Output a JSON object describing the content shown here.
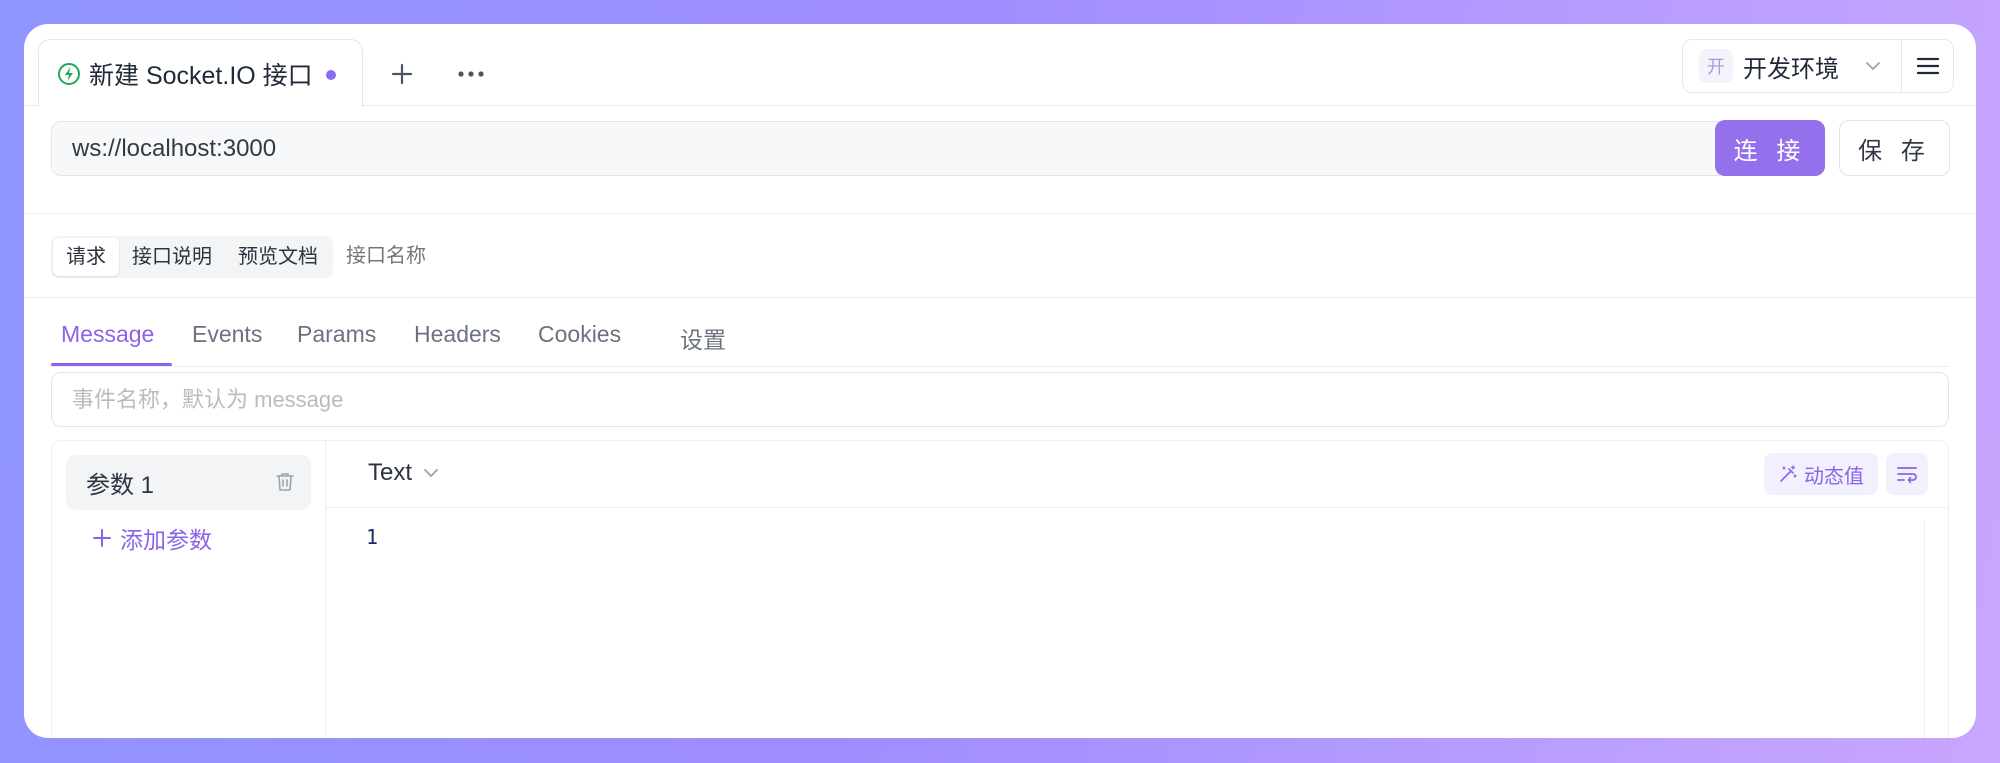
{
  "tab": {
    "title": "新建 Socket.IO 接口",
    "unsaved": true
  },
  "env": {
    "badge": "开",
    "name": "开发环境"
  },
  "url": {
    "value": "ws://localhost:3000"
  },
  "actions": {
    "connect_label": "连 接",
    "save_label": "保 存"
  },
  "segments": {
    "items": [
      "请求",
      "接口说明",
      "预览文档"
    ],
    "active": "请求",
    "api_name_placeholder": "接口名称"
  },
  "message_tabs": {
    "items": [
      "Message",
      "Events",
      "Params",
      "Headers",
      "Cookies",
      "设置"
    ],
    "active": "Message"
  },
  "event": {
    "placeholder": "事件名称，默认为 message"
  },
  "params": {
    "items": [
      "参数 1"
    ],
    "add_label": "添加参数"
  },
  "editor": {
    "format": "Text",
    "dynamic_label": "动态值",
    "line_numbers": [
      "1"
    ]
  },
  "colors": {
    "accent": "#8b63e8",
    "connect_button": "#9570ec",
    "status_icon": "#22a85a"
  },
  "icons": {
    "protocol": "socketio-icon",
    "add_tab": "plus-icon",
    "more": "more-dots-icon",
    "env_dropdown": "chevron-down-icon",
    "menu": "hamburger-menu-icon",
    "delete_param": "trash-icon",
    "add_param": "plus-icon",
    "format_dropdown": "chevron-down-icon",
    "dynamic_value": "magic-wand-icon",
    "wrap": "text-wrap-icon"
  }
}
